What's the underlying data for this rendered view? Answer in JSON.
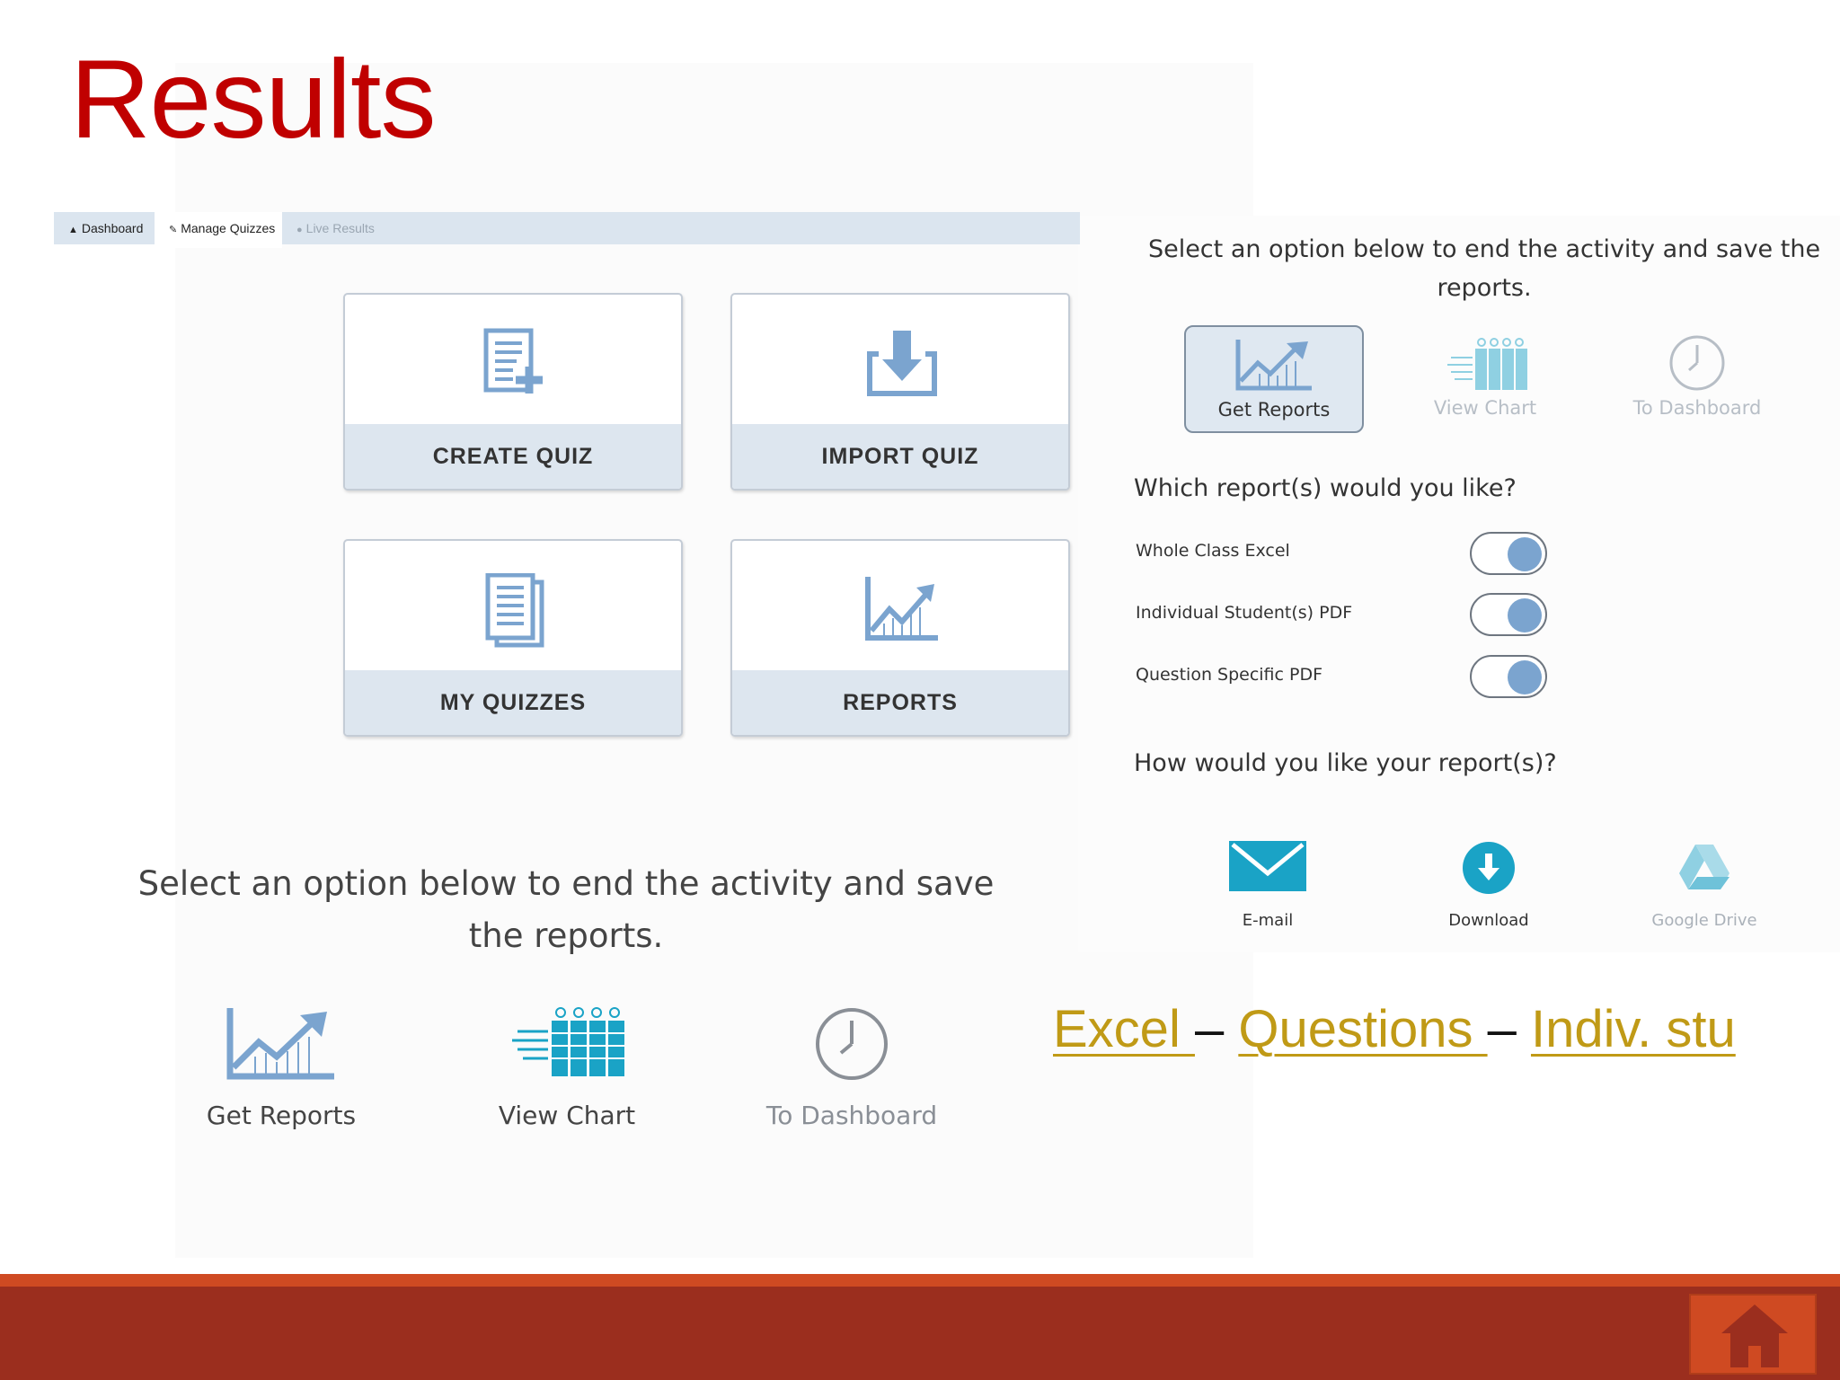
{
  "slide": {
    "title": "Results"
  },
  "nav": {
    "tabs": [
      {
        "label": "Dashboard",
        "icon": "home-icon"
      },
      {
        "label": "Manage Quizzes",
        "icon": "wrench-icon"
      },
      {
        "label": "Live Results",
        "icon": "dot-icon"
      }
    ]
  },
  "cards": [
    {
      "label": "CREATE QUIZ",
      "icon": "create-quiz-icon"
    },
    {
      "label": "IMPORT QUIZ",
      "icon": "import-icon"
    },
    {
      "label": "MY QUIZZES",
      "icon": "documents-icon"
    },
    {
      "label": "REPORTS",
      "icon": "chart-icon"
    }
  ],
  "end_activity_large": {
    "prompt": "Select an option below to end the activity and save the reports.",
    "options": [
      {
        "label": "Get Reports",
        "icon": "rising-chart-icon"
      },
      {
        "label": "View Chart",
        "icon": "bar-chart-icon"
      },
      {
        "label": "To Dashboard",
        "icon": "clock-icon"
      }
    ]
  },
  "end_activity_small": {
    "prompt": "Select an option below to end the activity and save the reports.",
    "options": [
      {
        "label": "Get Reports",
        "icon": "rising-chart-icon",
        "selected": true
      },
      {
        "label": "View Chart",
        "icon": "bar-chart-icon"
      },
      {
        "label": "To Dashboard",
        "icon": "clock-icon"
      }
    ]
  },
  "report_choice": {
    "heading": "Which report(s) would you like?",
    "items": [
      {
        "label": "Whole Class Excel",
        "on": true
      },
      {
        "label": "Individual Student(s) PDF",
        "on": true
      },
      {
        "label": "Question Specific PDF",
        "on": true
      }
    ]
  },
  "delivery": {
    "heading": "How would you like your report(s)?",
    "options": [
      {
        "label": "E-mail",
        "icon": "envelope-icon"
      },
      {
        "label": "Download",
        "icon": "download-icon"
      },
      {
        "label": "Google Drive",
        "icon": "google-drive-icon"
      }
    ]
  },
  "links": {
    "excel": "Excel ",
    "sep1": " – ",
    "questions": "Questions ",
    "sep2": " – ",
    "indiv": "Indiv. stu"
  },
  "colors": {
    "title": "#c00000",
    "link": "#c09a16",
    "footer": "#9b2e1e",
    "accent": "#cf4a22",
    "icon_blue": "#7ba4cf"
  }
}
